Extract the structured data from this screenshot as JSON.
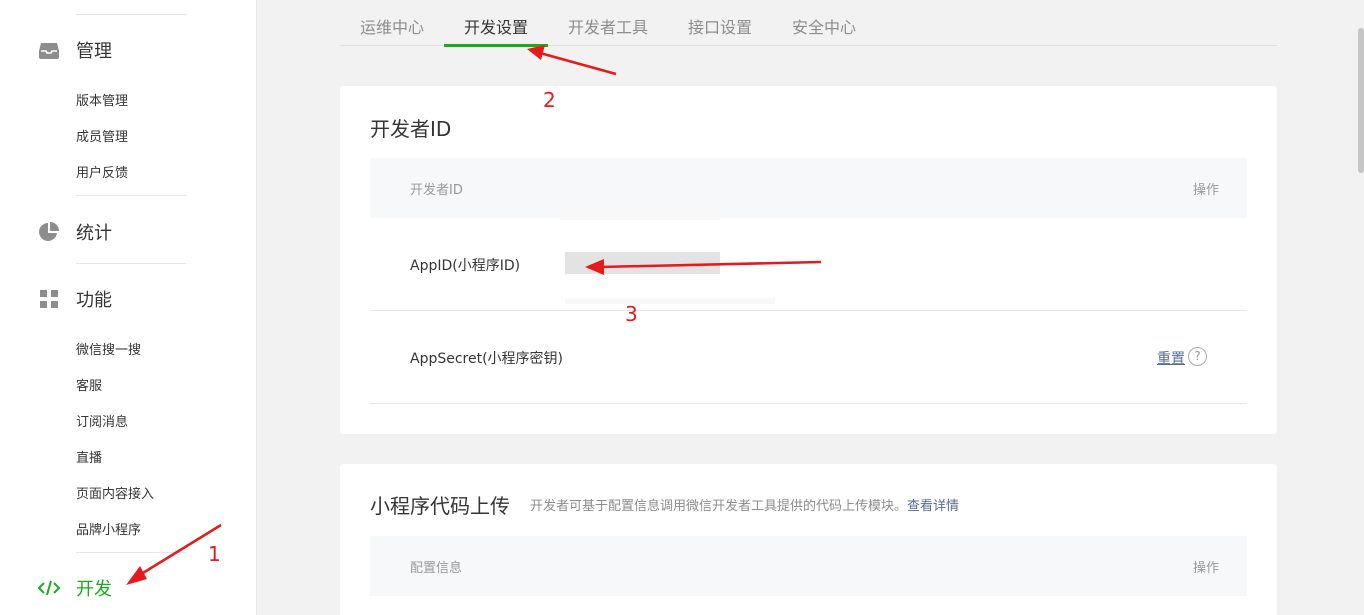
{
  "sidebar": {
    "manage": {
      "label": "管理",
      "items": [
        "版本管理",
        "成员管理",
        "用户反馈"
      ]
    },
    "stats": {
      "label": "统计"
    },
    "features": {
      "label": "功能",
      "items": [
        "微信搜一搜",
        "客服",
        "订阅消息",
        "直播",
        "页面内容接入",
        "品牌小程序"
      ]
    },
    "dev": {
      "label": "开发"
    }
  },
  "tabs": [
    "运维中心",
    "开发设置",
    "开发者工具",
    "接口设置",
    "安全中心"
  ],
  "active_tab": "开发设置",
  "dev_id_card": {
    "title": "开发者ID",
    "col_name": "开发者ID",
    "col_action": "操作",
    "rows": [
      {
        "name": "AppID(小程序ID)",
        "action": ""
      },
      {
        "name": "AppSecret(小程序密钥)",
        "action": "重置"
      }
    ],
    "help_icon": "?"
  },
  "upload_card": {
    "title": "小程序代码上传",
    "description": "开发者可基于配置信息调用微信开发者工具提供的代码上传模块。",
    "link": "查看详情",
    "col_name": "配置信息",
    "col_action": "操作"
  },
  "annotations": [
    "1",
    "2",
    "3"
  ],
  "colors": {
    "accent": "#1aad19",
    "link": "#576b95",
    "annotation": "#e8191a"
  }
}
